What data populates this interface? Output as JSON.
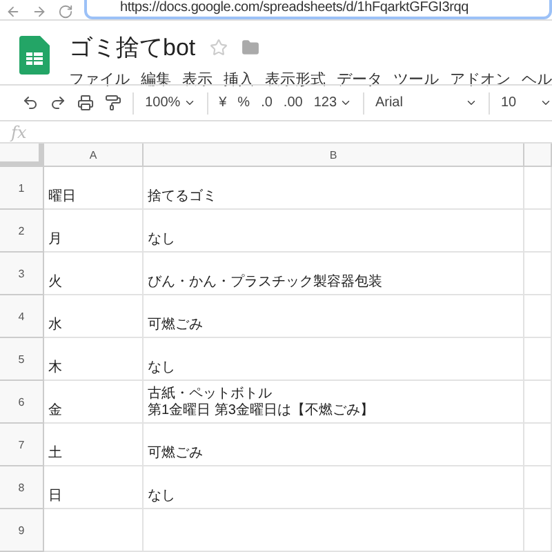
{
  "browser": {
    "url": "https://docs.google.com/spreadsheets/d/1hFqarktGFGI3rqq"
  },
  "document": {
    "title": "ゴミ捨てbot",
    "starred": false
  },
  "menu": [
    "ファイル",
    "編集",
    "表示",
    "挿入",
    "表示形式",
    "データ",
    "ツール",
    "アドオン",
    "ヘル"
  ],
  "toolbar": {
    "zoom": "100%",
    "currency": "¥",
    "percent": "%",
    "decrease_decimals": ".0",
    "increase_decimals": ".00",
    "number_format": "123",
    "font": "Arial",
    "font_size": "10"
  },
  "formula_bar": {
    "label": "fx"
  },
  "sheet": {
    "columns": [
      "A",
      "B"
    ],
    "rows": [
      {
        "number": "1",
        "cells": [
          [
            "曜日"
          ],
          [
            "捨てるゴミ"
          ]
        ]
      },
      {
        "number": "2",
        "cells": [
          [
            "月"
          ],
          [
            "なし"
          ]
        ]
      },
      {
        "number": "3",
        "cells": [
          [
            "火"
          ],
          [
            "びん・かん・プラスチック製容器包装"
          ]
        ]
      },
      {
        "number": "4",
        "cells": [
          [
            "水"
          ],
          [
            "可燃ごみ"
          ]
        ]
      },
      {
        "number": "5",
        "cells": [
          [
            "木"
          ],
          [
            "なし"
          ]
        ]
      },
      {
        "number": "6",
        "cells": [
          [
            "金"
          ],
          [
            "古紙・ペットボトル",
            "第1金曜日 第3金曜日は【不燃ごみ】"
          ]
        ]
      },
      {
        "number": "7",
        "cells": [
          [
            "土"
          ],
          [
            "可燃ごみ"
          ]
        ]
      },
      {
        "number": "8",
        "cells": [
          [
            "日"
          ],
          [
            "なし"
          ]
        ]
      },
      {
        "number": "9",
        "cells": [
          [],
          []
        ]
      }
    ]
  }
}
